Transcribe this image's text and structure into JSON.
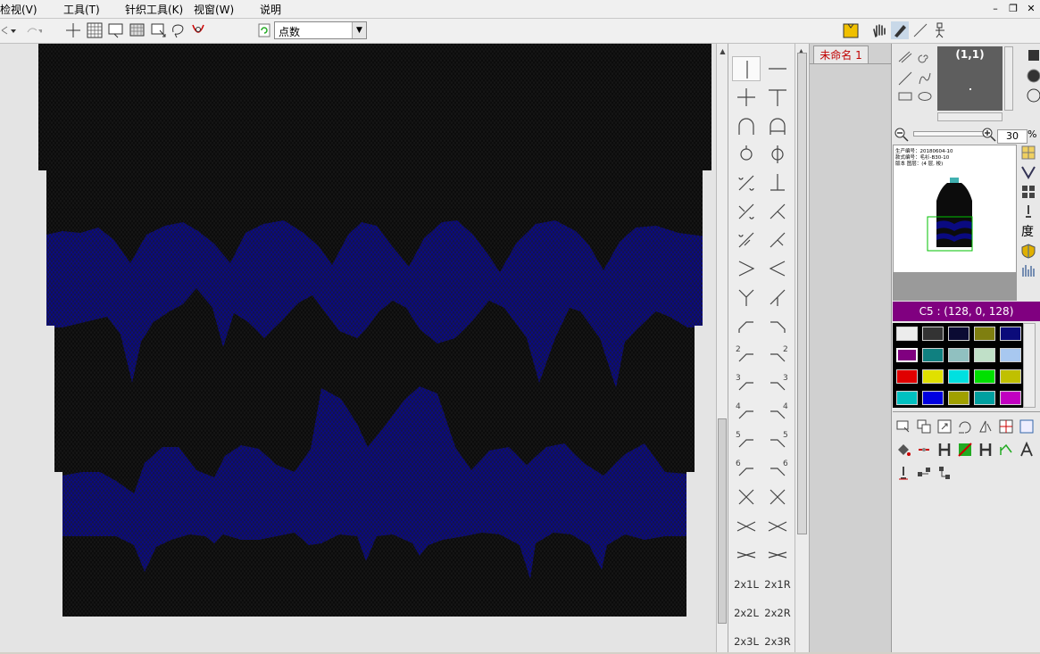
{
  "menu": {
    "view": "检视(V)",
    "tools": "工具(T)",
    "knit_tools": "针织工具(K)",
    "window": "视窗(W)",
    "help": "说明"
  },
  "window_controls": {
    "minimize": "–",
    "restore": "❐",
    "close": "✕"
  },
  "toolbar": {
    "mode_select_value": "点数"
  },
  "stitch_palette": {
    "text_items": [
      "2x1L",
      "2x1R",
      "2x2L",
      "2x2R",
      "2x3L",
      "2x3R"
    ],
    "digits": [
      "2",
      "2",
      "3",
      "3",
      "4",
      "4",
      "5",
      "5",
      "6",
      "6"
    ]
  },
  "document": {
    "tab_label": "未命名 1"
  },
  "navigator": {
    "coordinate": "(1,1)",
    "zoom_value": "30",
    "zoom_unit": "%"
  },
  "preview": {
    "info_lines": [
      "生产编号：20180604-10",
      "款式编号：毛衫-B30-10",
      "版本  图层：(4 层, 梭)"
    ]
  },
  "side_icons": {
    "degree_label": "度"
  },
  "color": {
    "selected_label": "C5 : (128, 0, 128)",
    "swatches": [
      "#ececec",
      "#333333",
      "#0b0b33",
      "#7f7f10",
      "#0b0b7a",
      "#800080",
      "#108080",
      "#90c0c0",
      "#c0e0c8",
      "#a8c8f0",
      "#e00000",
      "#e0e000",
      "#00e0e0",
      "#00e000",
      "#c0c000",
      "#00c0c0",
      "#0000e0",
      "#a0a000",
      "#00a0a0",
      "#c000c0"
    ],
    "selected_index": 5
  },
  "pattern": {
    "base_color": "#0c0c0c",
    "accent_color": "#0a0a80"
  }
}
